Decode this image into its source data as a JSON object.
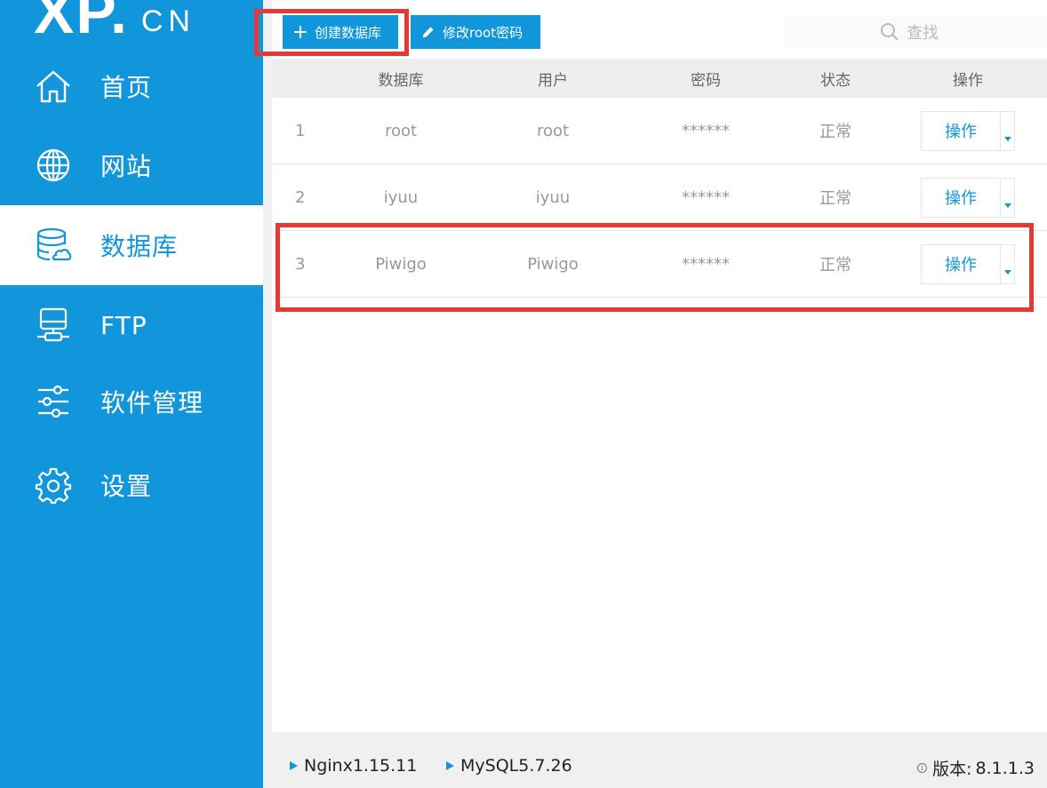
{
  "sidebar": {
    "logo_main": "XP.",
    "logo_cn": "CN",
    "items": [
      {
        "label": "首页",
        "icon": "home-icon"
      },
      {
        "label": "网站",
        "icon": "globe-icon"
      },
      {
        "label": "数据库",
        "icon": "database-icon",
        "active": true
      },
      {
        "label": "FTP",
        "icon": "ftp-server-icon"
      },
      {
        "label": "软件管理",
        "icon": "sliders-icon"
      },
      {
        "label": "设置",
        "icon": "gear-icon"
      }
    ]
  },
  "toolbar": {
    "create_label": "创建数据库",
    "root_pwd_label": "修改root密码",
    "search_placeholder": "查找"
  },
  "table": {
    "headers": {
      "database": "数据库",
      "user": "用户",
      "password": "密码",
      "state": "状态",
      "action": "操作"
    },
    "rows": [
      {
        "index": "1",
        "database": "root",
        "user": "root",
        "password": "******",
        "state": "正常",
        "action": "操作"
      },
      {
        "index": "2",
        "database": "iyuu",
        "user": "iyuu",
        "password": "******",
        "state": "正常",
        "action": "操作"
      },
      {
        "index": "3",
        "database": "Piwigo",
        "user": "Piwigo",
        "password": "******",
        "state": "正常",
        "action": "操作"
      }
    ]
  },
  "footer": {
    "services": [
      "Nginx1.15.11",
      "MySQL5.7.26"
    ],
    "version_label": "版本:",
    "version_value": "8.1.1.3"
  },
  "colors": {
    "accent": "#1296db",
    "highlight": "#e53935"
  }
}
